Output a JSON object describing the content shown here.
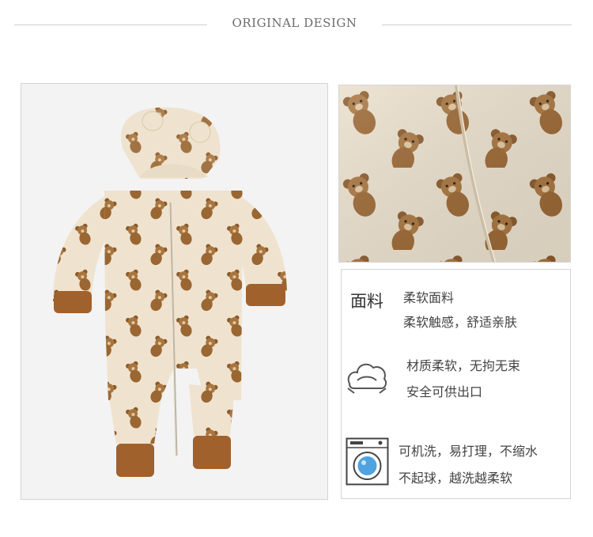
{
  "banner": {
    "title": "ORIGINAL DESIGN"
  },
  "fabric": {
    "heading": "面料",
    "line1": "柔软面料",
    "line2": "柔软触感，舒适亲肤",
    "line3": "材质柔软，无拘无束",
    "line4": "安全可供出口",
    "line5": "可机洗，易打理，不缩水",
    "line6": "不起球，越洗越柔软"
  },
  "icons": {
    "soft": "cloud-icon",
    "wash": "washing-machine-icon"
  },
  "colors": {
    "fabric_cream": "#efe3cf",
    "bear_brown": "#9a6a3a",
    "cuff_brown": "#a0612c",
    "washer_blue": "#4ea3e0"
  }
}
